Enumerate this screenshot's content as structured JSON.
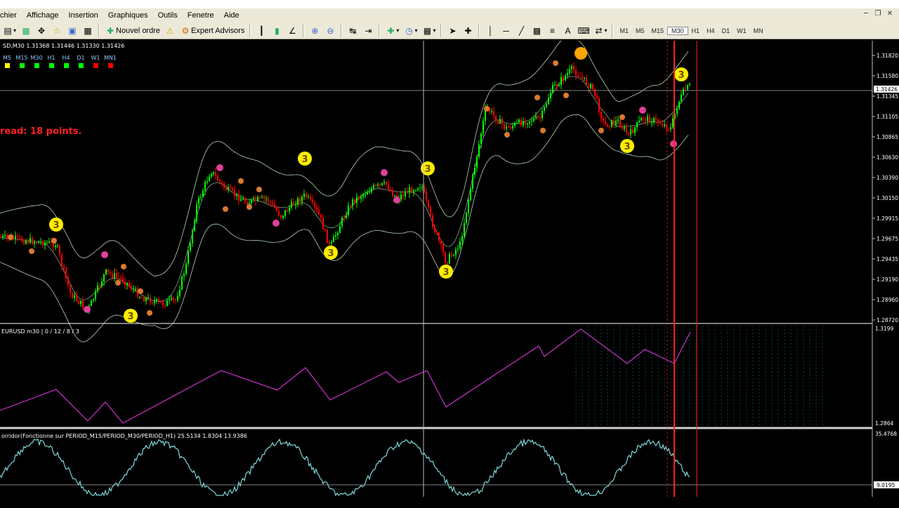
{
  "menu": [
    "chier",
    "Affichage",
    "Insertion",
    "Graphiques",
    "Outils",
    "Fenetre",
    "Aide"
  ],
  "toolbar": {
    "new_order": "Nouvel ordre",
    "expert_advisors": "Expert Advisors",
    "timeframes": [
      "M1",
      "M5",
      "M15",
      "M30",
      "H1",
      "H4",
      "D1",
      "W1",
      "MN"
    ],
    "active_timeframe": "M30"
  },
  "main": {
    "symbol_info": "SD,M30  1.31368 1.31446 1.31330 1.31426",
    "spread": "read:  18 points.",
    "tf_boxes": [
      {
        "label": "M5",
        "color": "#ffff00"
      },
      {
        "label": "M15",
        "color": "#00ff00"
      },
      {
        "label": "M30",
        "color": "#00ff00"
      },
      {
        "label": "H1",
        "color": "#00ff00"
      },
      {
        "label": "H4",
        "color": "#00ff00"
      },
      {
        "label": "D1",
        "color": "#00ff00"
      },
      {
        "label": "W1",
        "color": "#ff0000"
      },
      {
        "label": "MN1",
        "color": "#ff0000"
      }
    ],
    "price_labels": [
      "1.31820",
      "1.31580",
      "1.31345",
      "1.31105",
      "1.30865",
      "1.30630",
      "1.30390",
      "1.30150",
      "1.29915",
      "1.29675",
      "1.29435",
      "1.29190",
      "1.28960",
      "1.28720"
    ],
    "current_price": "1.31426",
    "marker_label": "3"
  },
  "sub1": {
    "title": "EURUSD m30 | 0 / 12 / 8 / 3",
    "scale": [
      "1.3199",
      "1.2864"
    ]
  },
  "sub2": {
    "title": "orridor(Fonctionne sur PERIOD_M15/PERIOD_M30/PERIOD_H1) 25.5134 1.8304 13.9386",
    "scale": [
      "35.4768",
      "9.0195"
    ]
  },
  "colors": {
    "bull": "#00ff00",
    "bear": "#ff0000",
    "bands": "#b4d4b4",
    "zigzag": "#cc33cc",
    "oscillator": "#7fd8d8",
    "marker_yellow": "#ffee00",
    "marker_pink": "#e0409a",
    "marker_orange": "#d87a30",
    "vline_red": "#ff2020"
  }
}
